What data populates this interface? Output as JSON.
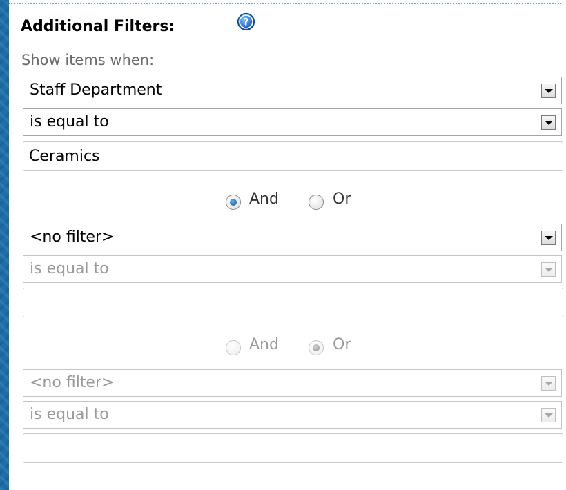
{
  "filters": {
    "heading": "Additional Filters:",
    "help_icon": "help-question-icon",
    "show_label": "Show items when:",
    "group1": {
      "field": "Staff Department",
      "operator": "is equal to",
      "value": "Ceramics"
    },
    "conjunction1": {
      "and_label": "And",
      "or_label": "Or",
      "selected": "And"
    },
    "group2": {
      "field": "<no filter>",
      "operator": "is equal to",
      "value": ""
    },
    "conjunction2": {
      "and_label": "And",
      "or_label": "Or",
      "selected": "Or"
    },
    "group3": {
      "field": "<no filter>",
      "operator": "is equal to",
      "value": ""
    }
  },
  "colors": {
    "accent_strip": "#1c6fa8",
    "radio_selected": "#0a4f8f",
    "disabled_text": "#9a9a9a"
  }
}
